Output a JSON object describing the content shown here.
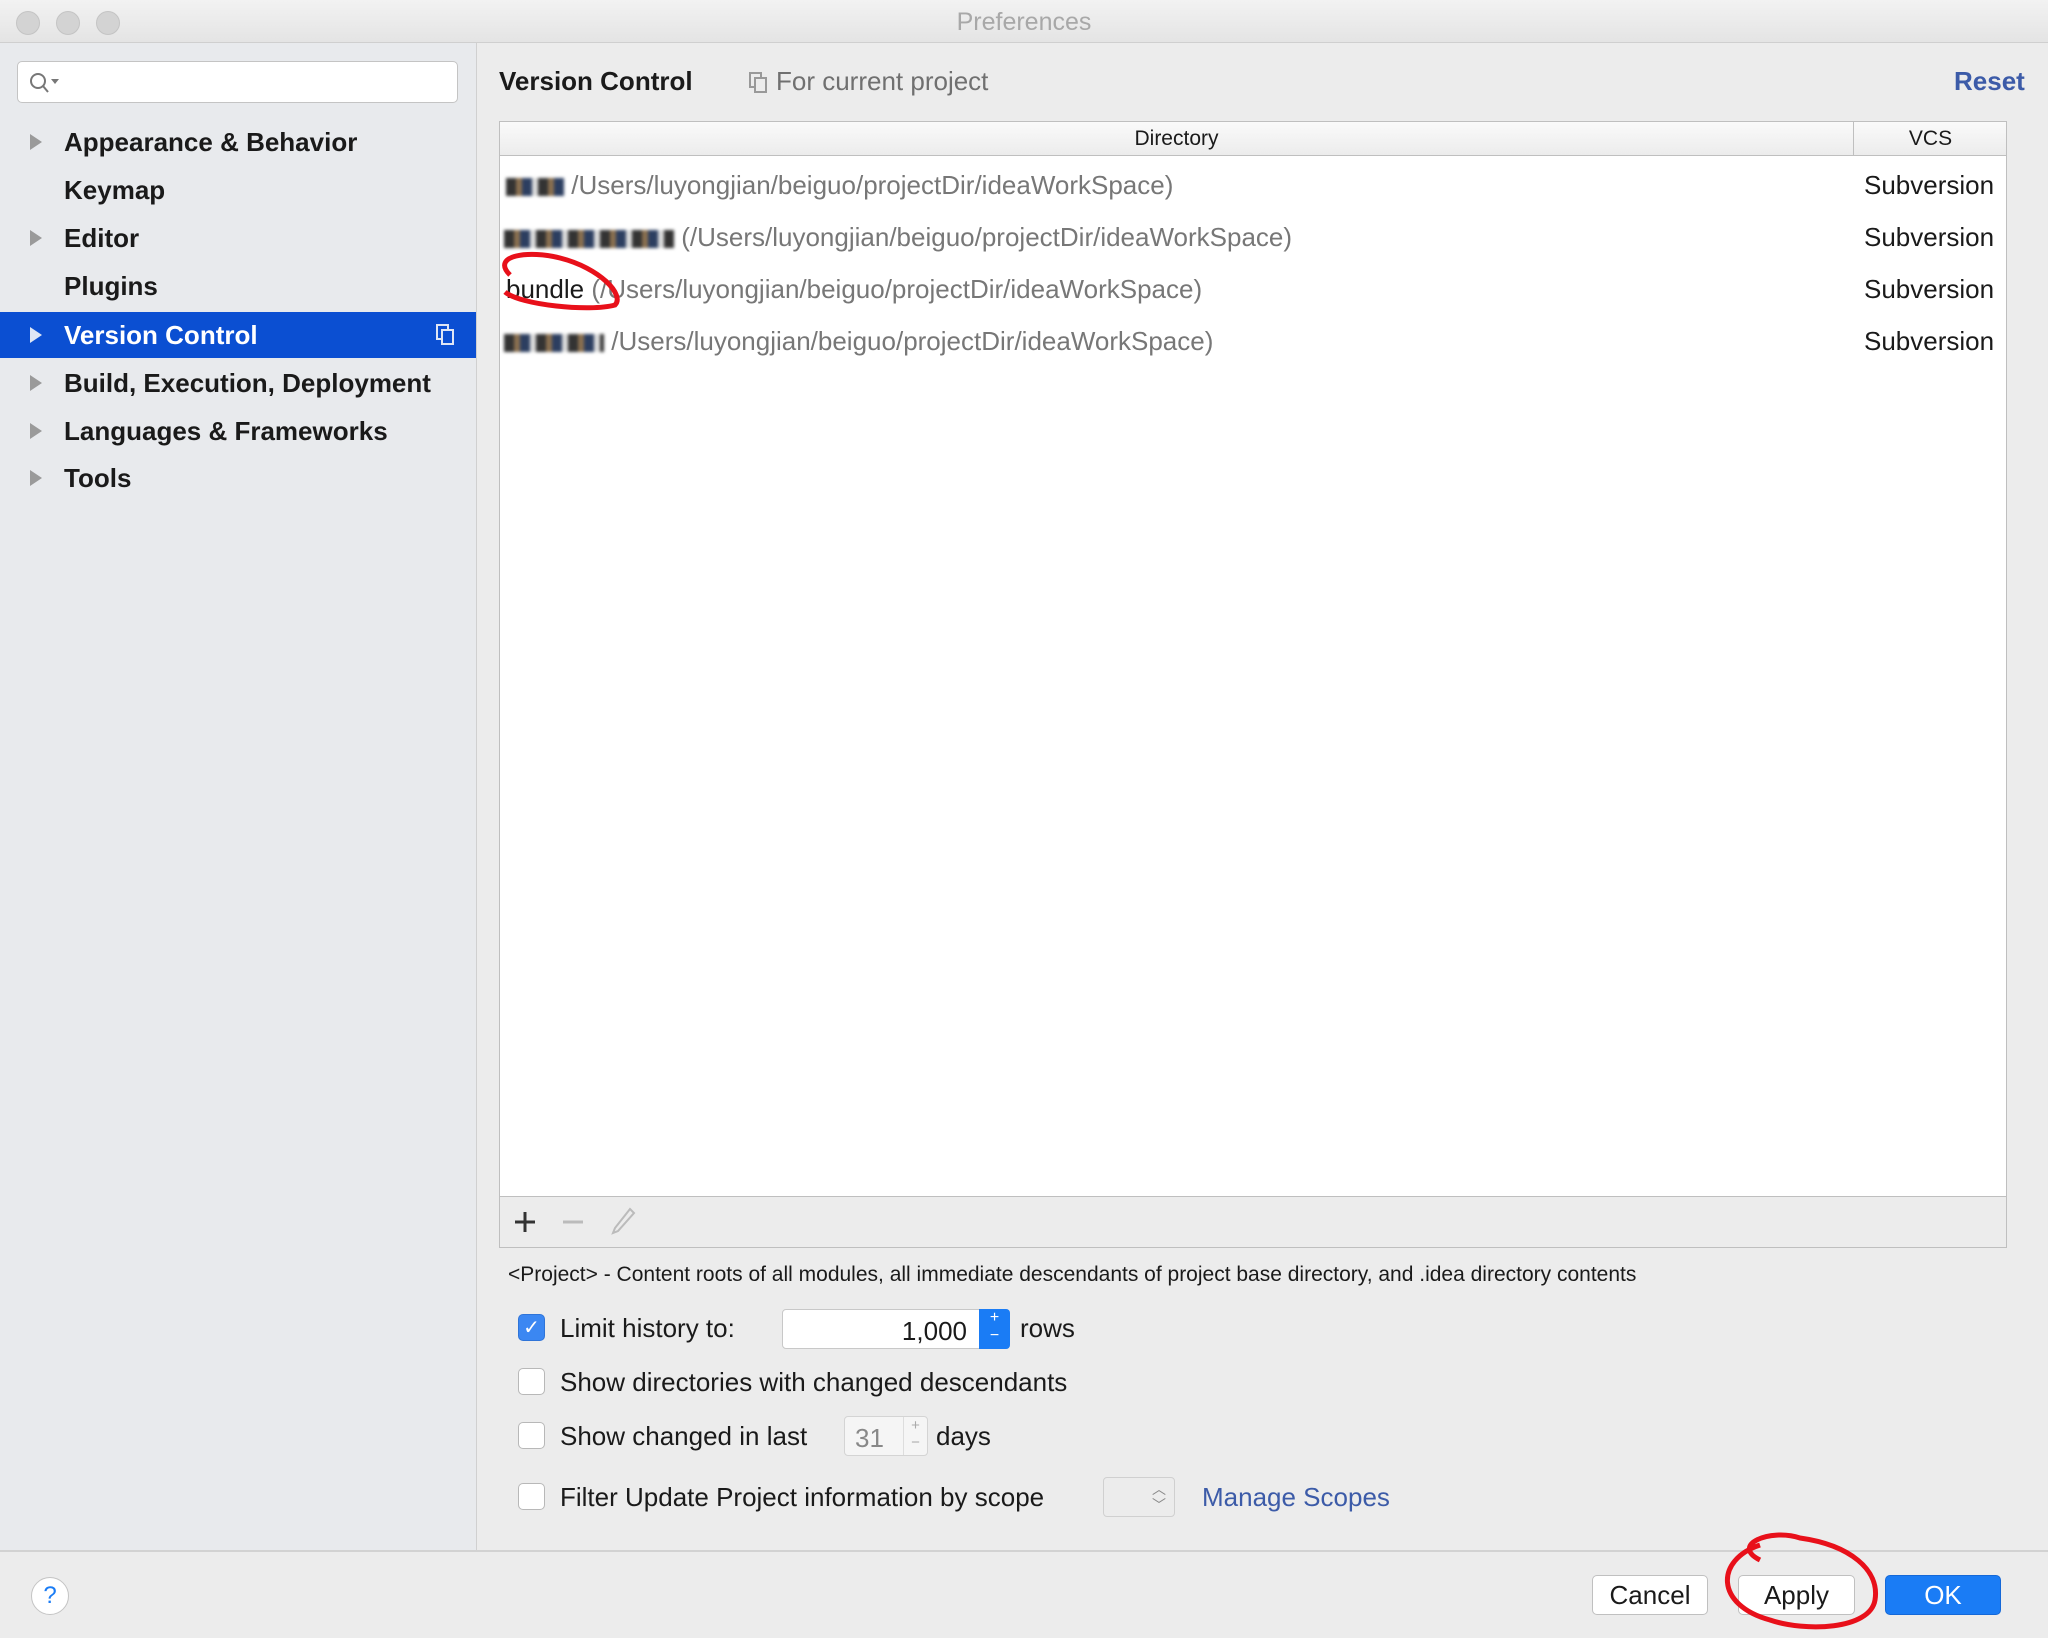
{
  "window": {
    "title": "Preferences"
  },
  "sidebar": {
    "search": {
      "value": "",
      "placeholder": ""
    },
    "items": [
      {
        "label": "Appearance & Behavior",
        "expandable": true
      },
      {
        "label": "Keymap",
        "expandable": false
      },
      {
        "label": "Editor",
        "expandable": true
      },
      {
        "label": "Plugins",
        "expandable": false
      },
      {
        "label": "Version Control",
        "expandable": true,
        "selected": true
      },
      {
        "label": "Build, Execution, Deployment",
        "expandable": true
      },
      {
        "label": "Languages & Frameworks",
        "expandable": true
      },
      {
        "label": "Tools",
        "expandable": true
      }
    ]
  },
  "main": {
    "title": "Version Control",
    "scope_label": "For current project",
    "reset_label": "Reset",
    "table": {
      "columns": [
        "Directory",
        "VCS"
      ],
      "rows": [
        {
          "name": "",
          "path": "/Users/luyongjian/beiguo/projectDir/ideaWorkSpace)",
          "vcs": "Subversion"
        },
        {
          "name": "",
          "path": "(/Users/luyongjian/beiguo/projectDir/ideaWorkSpace)",
          "vcs": "Subversion"
        },
        {
          "name": "bundle",
          "path": "(/Users/luyongjian/beiguo/projectDir/ideaWorkSpace)",
          "vcs": "Subversion"
        },
        {
          "name": "",
          "path": "/Users/luyongjian/beiguo/projectDir/ideaWorkSpace)",
          "vcs": "Subversion"
        }
      ]
    },
    "note": "<Project> - Content roots of all modules, all immediate descendants of project base directory, and .idea directory contents",
    "options": {
      "limit_history": {
        "checked": true,
        "label": "Limit history to:",
        "value": "1,000",
        "suffix": "rows"
      },
      "show_dirs": {
        "checked": false,
        "label": "Show directories with changed descendants"
      },
      "show_changed": {
        "checked": false,
        "label": "Show changed in last",
        "value": "31",
        "suffix": "days"
      },
      "filter_scope": {
        "checked": false,
        "label": "Filter Update Project information by scope",
        "link": "Manage Scopes"
      }
    }
  },
  "footer": {
    "help": "?",
    "cancel": "Cancel",
    "apply": "Apply",
    "ok": "OK"
  },
  "colors": {
    "accent": "#0b4fd2",
    "ok_button": "#1a7cf5",
    "annotation": "#e8101a"
  }
}
